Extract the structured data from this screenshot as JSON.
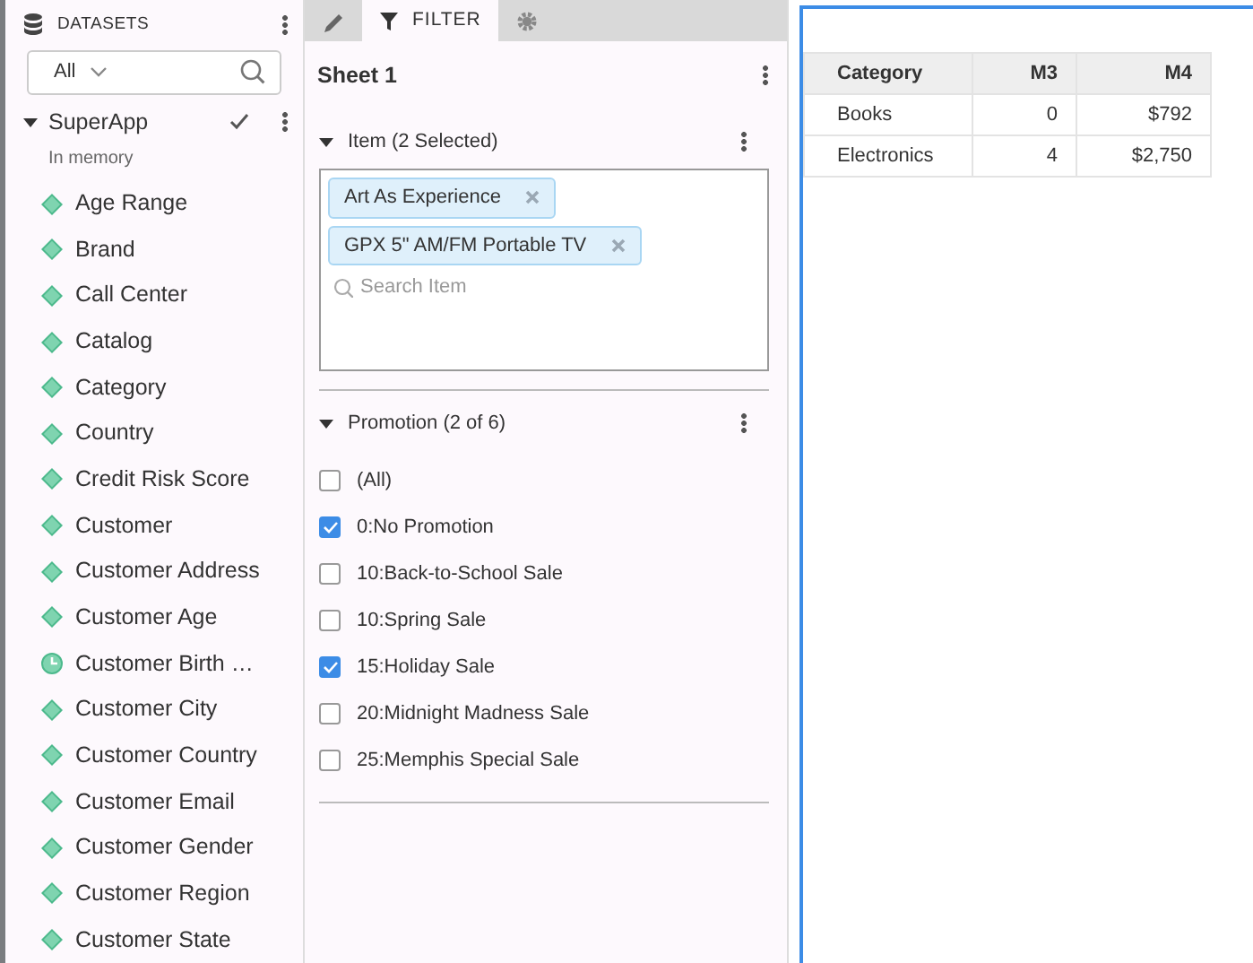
{
  "datasets_panel": {
    "title": "DATASETS",
    "filter": {
      "value": "All"
    },
    "dataset": {
      "name": "SuperApp",
      "expanded": true,
      "loaded": true,
      "subtitle": "In memory",
      "fields": [
        {
          "name": "Age Range",
          "kind": "attribute"
        },
        {
          "name": "Brand",
          "kind": "attribute"
        },
        {
          "name": "Call Center",
          "kind": "attribute"
        },
        {
          "name": "Catalog",
          "kind": "attribute"
        },
        {
          "name": "Category",
          "kind": "attribute"
        },
        {
          "name": "Country",
          "kind": "attribute"
        },
        {
          "name": "Credit Risk Score",
          "kind": "attribute"
        },
        {
          "name": "Customer",
          "kind": "attribute"
        },
        {
          "name": "Customer Address",
          "kind": "attribute"
        },
        {
          "name": "Customer Age",
          "kind": "attribute"
        },
        {
          "name": "Customer Birth …",
          "kind": "date"
        },
        {
          "name": "Customer City",
          "kind": "attribute"
        },
        {
          "name": "Customer Country",
          "kind": "attribute"
        },
        {
          "name": "Customer Email",
          "kind": "attribute"
        },
        {
          "name": "Customer Gender",
          "kind": "attribute"
        },
        {
          "name": "Customer Region",
          "kind": "attribute"
        },
        {
          "name": "Customer State",
          "kind": "attribute"
        }
      ]
    }
  },
  "editor_tabs": [
    {
      "kind": "edit",
      "selected": false
    },
    {
      "kind": "filter",
      "label": "FILTER",
      "selected": true
    },
    {
      "kind": "settings",
      "selected": false
    }
  ],
  "filter_panel": {
    "title": "Sheet 1",
    "filters": [
      {
        "kind": "chips",
        "title": "Item (2 Selected)",
        "expanded": true,
        "chips": [
          "Art As Experience",
          "GPX 5\" AM/FM Portable TV"
        ],
        "placeholder": "Search Item"
      },
      {
        "kind": "checklist",
        "title": "Promotion (2 of 6)",
        "expanded": true,
        "options": [
          {
            "label": "(All)",
            "checked": false
          },
          {
            "label": "0:No Promotion",
            "checked": true
          },
          {
            "label": "10:Back-to-School Sale",
            "checked": false
          },
          {
            "label": "10:Spring Sale",
            "checked": false
          },
          {
            "label": "15:Holiday Sale",
            "checked": true
          },
          {
            "label": "20:Midnight Madness Sale",
            "checked": false
          },
          {
            "label": "25:Memphis Special Sale",
            "checked": false
          }
        ]
      }
    ]
  },
  "grid": {
    "columns": [
      {
        "label": "Category"
      },
      {
        "label": "M3"
      },
      {
        "label": "M4"
      }
    ],
    "rows": [
      [
        "Books",
        "0",
        "$792"
      ],
      [
        "Electronics",
        "4",
        "$2,750"
      ]
    ]
  }
}
